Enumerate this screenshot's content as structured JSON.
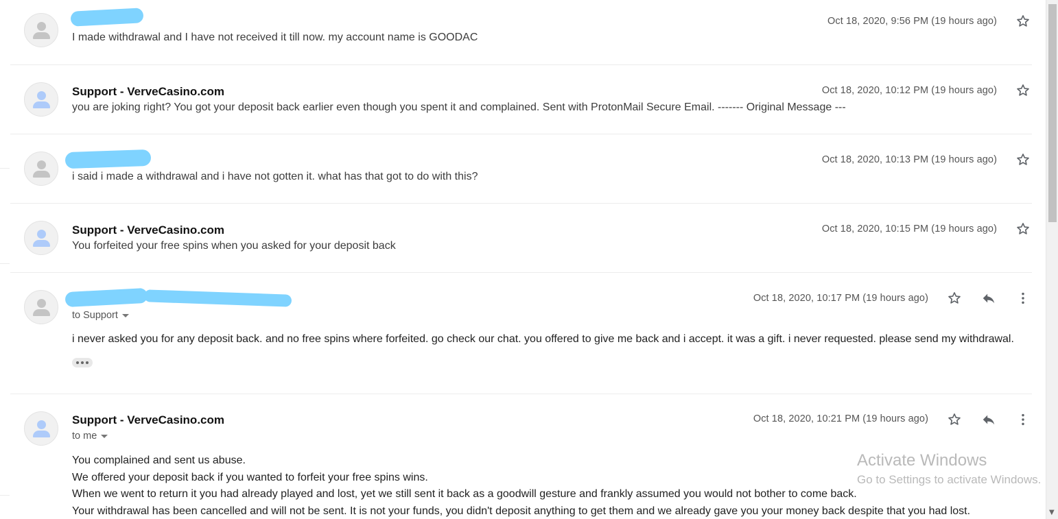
{
  "messages": [
    {
      "sender": "",
      "date": "Oct 18, 2020, 9:56 PM (19 hours ago)",
      "snippet": "I made withdrawal and I have not received it till now. my account name is GOODAC",
      "avatar_color": "#c4c4c4",
      "redacted": true
    },
    {
      "sender": "Support - VerveCasino.com",
      "date": "Oct 18, 2020, 10:12 PM (19 hours ago)",
      "snippet": "you are joking right? You got your deposit back earlier even though you spent it and complained. Sent with ProtonMail Secure Email. ------- Original Message ---",
      "avatar_color": "#aecbfa"
    },
    {
      "sender": "",
      "date": "Oct 18, 2020, 10:13 PM (19 hours ago)",
      "snippet": "i said i made a withdrawal and i have not gotten it. what has that got to do with this?",
      "avatar_color": "#c4c4c4",
      "redacted": true
    },
    {
      "sender": "Support - VerveCasino.com",
      "date": "Oct 18, 2020, 10:15 PM (19 hours ago)",
      "snippet": "You forfeited your free spins when you asked for your deposit back",
      "avatar_color": "#aecbfa"
    },
    {
      "sender": "",
      "date": "Oct 18, 2020, 10:17 PM (19 hours ago)",
      "to": "to Support",
      "body": "i never asked you for any deposit back. and no free spins where forfeited. go check our chat. you offered to give me back and i accept. it was a gift. i never requested. please send my withdrawal.",
      "avatar_color": "#c4c4c4",
      "redacted": true
    },
    {
      "sender": "Support - VerveCasino.com",
      "date": "Oct 18, 2020, 10:21 PM (19 hours ago)",
      "to": "to me",
      "body_lines": [
        "You complained and sent us abuse.",
        "We offered your deposit back if you wanted to forfeit your free spins wins.",
        "When we went to return it you had already played and lost, yet we still sent it back as a goodwill gesture and frankly assumed you would not bother to come back.",
        "Your withdrawal has been cancelled and will not be sent. It is not your funds, you didn't deposit anything to get them and we already gave you your money back despite that you had lost."
      ],
      "avatar_color": "#aecbfa"
    }
  ],
  "icons": {
    "star": "star-icon",
    "reply": "reply-icon",
    "more": "more-vert-icon",
    "expand": "ellipsis-icon",
    "avatar": "person-icon"
  },
  "watermark": {
    "title": "Activate Windows",
    "subtitle": "Go to Settings to activate Windows."
  },
  "colors": {
    "redaction": "#7fd3ff",
    "divider": "#ececec",
    "icon": "#5f6368"
  }
}
